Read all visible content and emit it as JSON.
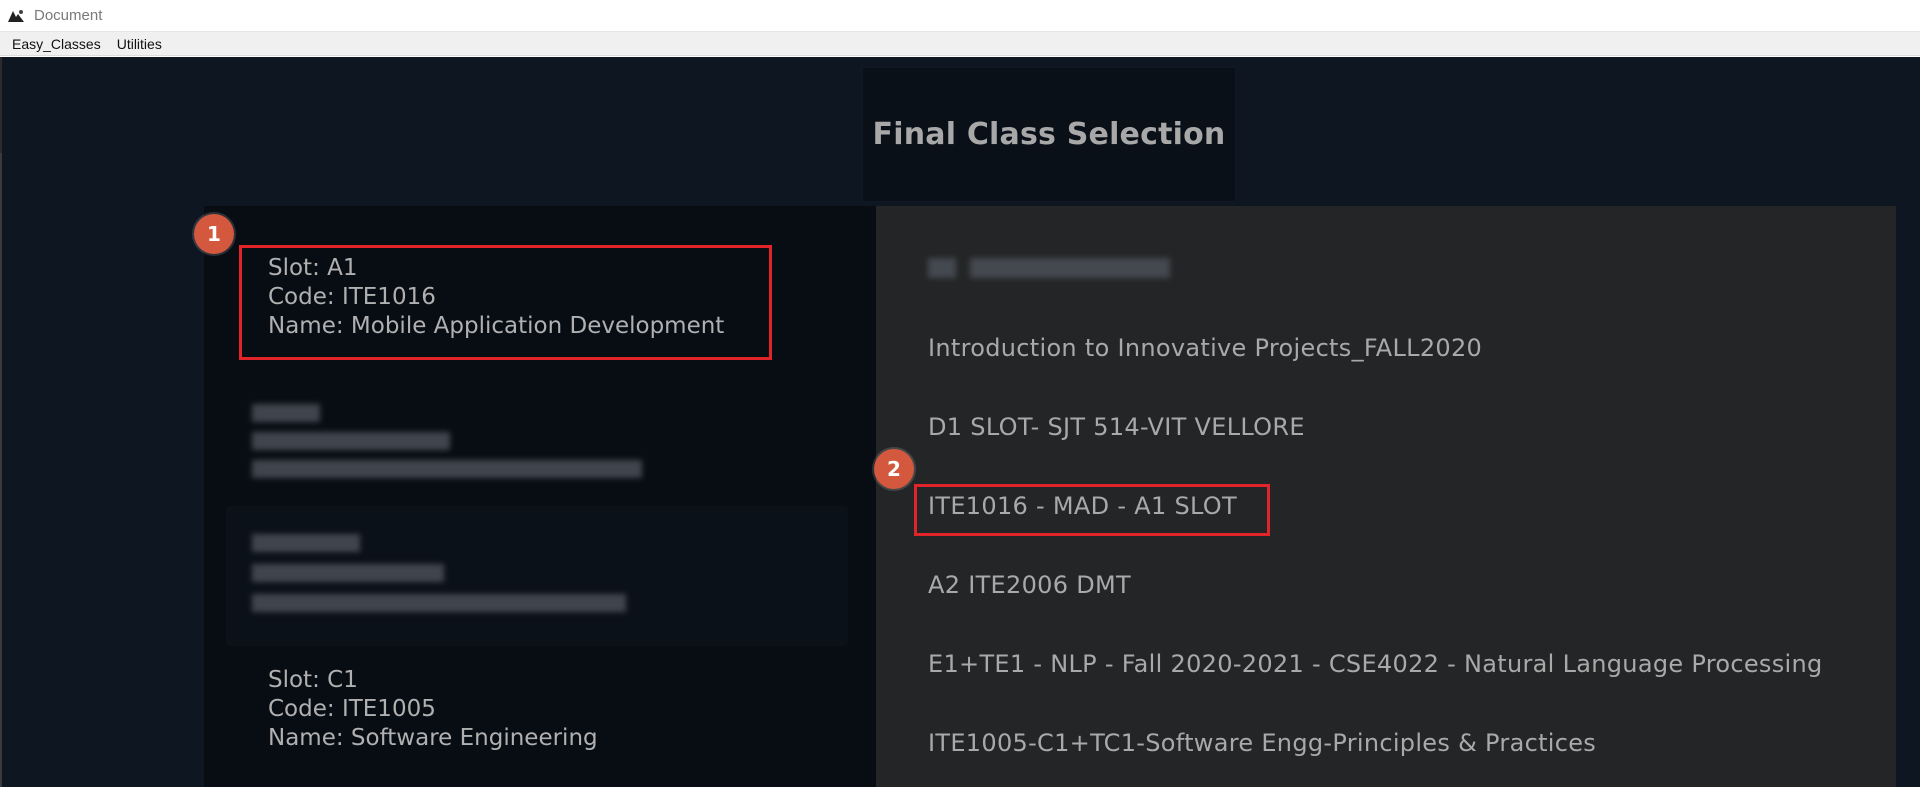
{
  "window": {
    "title": "Document"
  },
  "menubar": {
    "items": [
      {
        "label": "Easy_Classes"
      },
      {
        "label": "Utilities"
      }
    ]
  },
  "header": {
    "title": "Final Class Selection"
  },
  "left_panel": {
    "cards": [
      {
        "slot": "Slot: A1",
        "code": "Code: ITE1016",
        "name": "Name: Mobile Application Development",
        "highlighted": true
      },
      {
        "slot": "Slot: C1",
        "code": "Code: ITE1005",
        "name": "Name: Software Engineering",
        "highlighted": false
      }
    ]
  },
  "right_panel": {
    "items": [
      {
        "label": "Introduction to Innovative Projects_FALL2020"
      },
      {
        "label": "D1 SLOT- SJT 514-VIT VELLORE"
      },
      {
        "label": "ITE1016 - MAD - A1 SLOT"
      },
      {
        "label": "A2 ITE2006 DMT"
      },
      {
        "label": "E1+TE1 - NLP - Fall 2020-2021 - CSE4022 - Natural Language Processing"
      },
      {
        "label": "ITE1005-C1+TC1-Software Engg-Principles & Practices"
      }
    ]
  },
  "annotations": {
    "badges": [
      {
        "label": "1"
      },
      {
        "label": "2"
      }
    ],
    "highlight_color": "#e0242a",
    "badge_color": "#d3583e"
  },
  "colors": {
    "app_background": "#0e1621",
    "left_panel": "#080d14",
    "right_panel": "#242526",
    "text": "#b0b0b0"
  }
}
